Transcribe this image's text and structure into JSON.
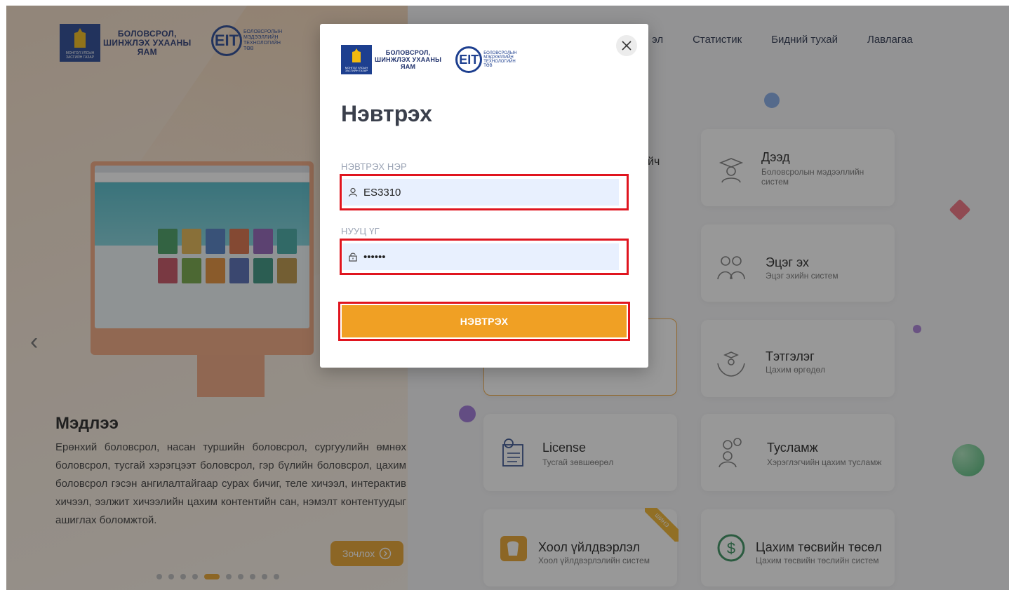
{
  "header": {
    "moe_logo_caption": "МОНГОЛ УЛСЫН ЗАСГИЙН ГАЗАР",
    "moe_name_line1": "БОЛОВСРОЛ,",
    "moe_name_line2": "ШИНЖЛЭХ УХААНЫ",
    "moe_name_line3": "ЯАМ",
    "eit_mark": "EIT",
    "eit_line1": "БОЛОВСРОЛЫН",
    "eit_line2": "МЭДЭЭЛЛИЙН",
    "eit_line3": "ТЕХНОЛОГИЙН",
    "eit_line4": "ТӨВ",
    "nav_partial": "эл",
    "nav": [
      "Статистик",
      "Бидний тухай",
      "Лавлагаа"
    ]
  },
  "hero": {
    "title": "Мэдлээ",
    "description": "Ерөнхий боловсрол, насан туршийн боловсрол, сургуулийн өмнөх боловсрол, тусгай хэрэгцээт боловсрол, гэр бүлийн боловсрол, цахим боловсрол гэсэн ангилалтайгаар сурах бичиг, теле хичээл, интерактив хичээл, ээлжит хичээлийн цахим контентийн сан, нэмэлт контентуудыг ашиглах боломжтой.",
    "cta_label": "Зочлох",
    "prev_arrow": "‹",
    "slide_count": 10,
    "active_slide": 5
  },
  "cards": [
    {
      "title": "Дээд",
      "subtitle": "Боловсролын мэдээллийн систем",
      "icon": "graduate-icon"
    },
    {
      "title": "Эцэг эх",
      "subtitle": "Эцэг эхийн систем",
      "icon": "parents-icon"
    },
    {
      "title": "Тэтгэлэг",
      "subtitle": "Цахим өргөдөл",
      "icon": "scholarship-icon"
    },
    {
      "title": "License",
      "subtitle": "Тусгай зөвшөөрөл",
      "icon": "license-icon"
    },
    {
      "title": "Тусламж",
      "subtitle": "Хэрэглэгчийн цахим тусламж",
      "icon": "help-icon"
    },
    {
      "title": "Хоол үйлдвэрлэл",
      "subtitle": "Хоол үйлдвэрлэлийн систем",
      "icon": "food-icon",
      "ribbon": "ШИНЭ"
    },
    {
      "title": "Цахим төсвийн төсөл",
      "subtitle": "Цахим төсвийн төслийн систем",
      "icon": "dollar-icon"
    }
  ],
  "partial_card_text": "йч",
  "modal": {
    "title": "Нэвтрэх",
    "username_label": "НЭВТРЭХ НЭР",
    "username_value": "ES3310",
    "password_label": "НУУЦ ҮГ",
    "password_value": "••••••",
    "submit_label": "НЭВТРЭХ",
    "close_symbol": "×"
  },
  "colors": {
    "accent": "#F0A024",
    "highlight_outline": "#E0151F",
    "brand_blue": "#1D3F8F"
  }
}
